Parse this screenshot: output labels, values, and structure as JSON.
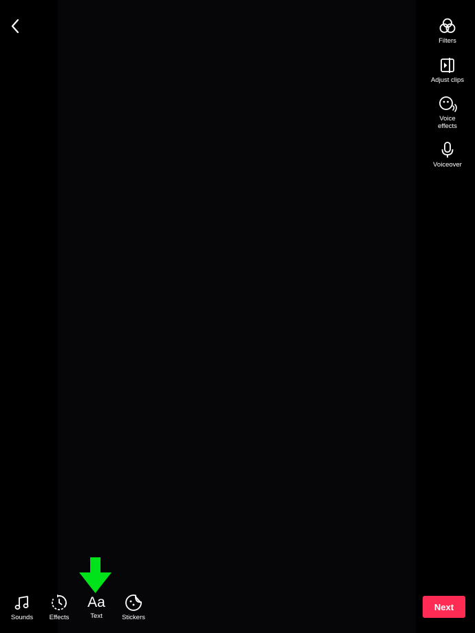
{
  "header": {
    "back_icon": "chevron-left-icon"
  },
  "side_tools": [
    {
      "label": "Filters",
      "icon": "filters-icon"
    },
    {
      "label": "Adjust clips",
      "icon": "adjust-clips-icon"
    },
    {
      "label": "Voice\neffects",
      "icon": "voice-effects-icon"
    },
    {
      "label": "Voiceover",
      "icon": "microphone-icon"
    }
  ],
  "bottom_tools": [
    {
      "label": "Sounds",
      "icon": "music-note-icon"
    },
    {
      "label": "Effects",
      "icon": "effects-icon"
    },
    {
      "label": "Text",
      "icon": "text-icon",
      "glyph": "Aa"
    },
    {
      "label": "Stickers",
      "icon": "stickers-icon"
    }
  ],
  "annotation": {
    "icon": "green-arrow-icon",
    "color": "#00e21a"
  },
  "next_button": {
    "label": "Next",
    "color": "#fe2c55"
  },
  "colors": {
    "background": "#000000",
    "preview": "#060609",
    "text": "#ffffff"
  }
}
